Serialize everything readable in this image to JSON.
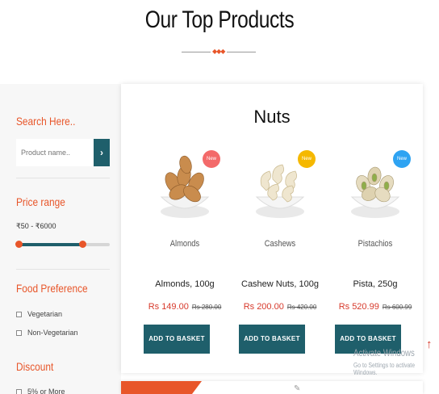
{
  "header": {
    "title": "Our Top Products"
  },
  "colors": {
    "accent": "#e8562a",
    "primary": "#1f5f6b",
    "price": "#d73a2c"
  },
  "sidebar": {
    "search": {
      "title": "Search Here..",
      "placeholder": "Product name..",
      "button_icon": "›"
    },
    "price": {
      "title": "Price range",
      "range_text": "₹50  -  ₹6000",
      "level_fraction": 0.7
    },
    "food": {
      "title": "Food Preference",
      "options": [
        "Vegetarian",
        "Non-Vegetarian"
      ]
    },
    "discount": {
      "title": "Discount",
      "options": [
        "5% or More"
      ]
    }
  },
  "main": {
    "category": "Nuts",
    "products": [
      {
        "badge": "New",
        "badge_color": "#f36a6a",
        "caption": "Almonds",
        "name": "Almonds, 100g",
        "price": "Rs 149.00",
        "old_price": "Rs 280.00",
        "button": "ADD TO BASKET"
      },
      {
        "badge": "New",
        "badge_color": "#f5b800",
        "caption": "Cashews",
        "name": "Cashew Nuts, 100g",
        "price": "Rs 200.00",
        "old_price": "Rs 420.00",
        "button": "ADD TO BASKET"
      },
      {
        "badge": "New",
        "badge_color": "#2ea3f2",
        "caption": "Pistachios",
        "name": "Pista, 250g",
        "price": "Rs 520.99",
        "old_price": "Rs 600.99",
        "button": "ADD TO BASKET"
      }
    ]
  },
  "watermark": {
    "title": "Activate Windows",
    "subtitle": "Go to Settings to activate Windows."
  }
}
